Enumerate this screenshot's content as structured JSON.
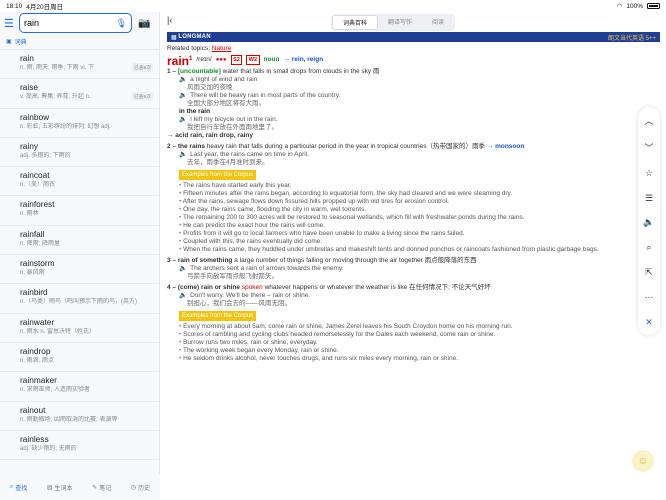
{
  "status": {
    "time": "18:10",
    "date": "4月20日周日",
    "battery": "100%"
  },
  "search": {
    "value": "rain"
  },
  "dict_label": "词典",
  "words": [
    {
      "w": "rain",
      "d": "n. 雨; 雨天; 雨季; 下雨 vi. 下",
      "tag": "已查5次"
    },
    {
      "w": "raise",
      "d": "v. 提高; 筹集; 养育; 升起 n.",
      "tag": "已查9次"
    },
    {
      "w": "rainbow",
      "d": "n. 彩虹; 五彩缤纷的排列; 幻想 adj.",
      "tag": ""
    },
    {
      "w": "rainy",
      "d": "adj. 多雨的; 下雨的",
      "tag": ""
    },
    {
      "w": "raincoat",
      "d": "n.（美）雨衣",
      "tag": ""
    },
    {
      "w": "rainforest",
      "d": "n. 雨林",
      "tag": ""
    },
    {
      "w": "rainfall",
      "d": "n. 降雨; 降雨量",
      "tag": ""
    },
    {
      "w": "rainstorm",
      "d": "n. 暴风雨",
      "tag": ""
    },
    {
      "w": "rainbird",
      "d": "n.（鸟类）雨鸟（鸣叫预示下雨的鸟，(英方)",
      "tag": ""
    },
    {
      "w": "rainwater",
      "d": "n. 雨水 n. 雷恩沃特（姓氏）",
      "tag": ""
    },
    {
      "w": "raindrop",
      "d": "n. 雨滴; 雨点",
      "tag": ""
    },
    {
      "w": "rainmaker",
      "d": "n. 求雨巫师; 人造雨实验者",
      "tag": ""
    },
    {
      "w": "rainout",
      "d": "n. 雨勤撤场; 因雨取消的比赛; 表演等",
      "tag": ""
    },
    {
      "w": "rainless",
      "d": "adj. 缺少雨的; 无雨的",
      "tag": ""
    }
  ],
  "nav": [
    "查找",
    "生词本",
    "笔记",
    "历史"
  ],
  "tabs": [
    "词典百科",
    "翻译写作",
    "阅读"
  ],
  "band": {
    "brand": "LONGMAN",
    "cn": "朗文当代英语 5++"
  },
  "entry": {
    "related_label": "Related topics:",
    "related": "Nature",
    "word": "rain",
    "sup": "1",
    "pron": "/reɪn/",
    "dots": "●●●",
    "s": "S2",
    "w": "W2",
    "pos": "noun",
    "refs": "→ rein, reign",
    "s1": {
      "num": "1 –",
      "gram": "[uncountable]",
      "def": "water that falls in small drops from clouds in the sky 雨",
      "ex": [
        {
          "en": "a night of wind and rain",
          "zh": "风雨交加的夜晚"
        },
        {
          "en": "There will be heavy rain in most parts of the country.",
          "zh": "全国大部分地区将有大雨。"
        }
      ],
      "phrase": "in the rain",
      "ex2": {
        "en": "I left my bicycle out in the rain.",
        "zh": "我把自行车放在外面雨地里了。"
      },
      "see": "→ acid rain, rain drop, rainy"
    },
    "s2": {
      "num": "2 –",
      "head": "the rains",
      "def": "heavy rain that falls during a particular period in the year in tropical countries（热带国家的）雨季",
      "see": "→ monsoon",
      "ex": {
        "en": "Last year, the rains came on time in April.",
        "zh": "去年，雨季在4月准时到来。"
      }
    },
    "corpus_label": "Examples from the Corpus",
    "c2": [
      "The rains have started early this year.",
      "Fifteen minutes after the rains began, according to equatorial form, the sky had cleared and we were steaming dry.",
      "After the rains, sewage flows down fissured hills propped up with old tires for erosion control.",
      "One day, the rains came, flooding the city in warm, wet torrents.",
      "The remaining 200 to 300 acres will be restored to seasonal wetlands, which fill with freshwater ponds during the rains.",
      "He can predict the exact hour the rains will come.",
      "Profits from it will go to local farmers who have been unable to make a living since the rains failed.",
      "Coupled with this, the rains eventually did come.",
      "When the rains came, they huddled under umbrellas and makeshift tents and donned ponchos or raincoats fashioned from plastic garbage bags."
    ],
    "s3": {
      "num": "3 –",
      "head": "rain of something",
      "def": "a large number of things falling or moving through the air together 雨点般降落的东西",
      "ex": {
        "en": "The archers sent a rain of arrows towards the enemy.",
        "zh": "弓箭手向敌军雨点般飞射箭矢。"
      }
    },
    "s4": {
      "num": "4 –",
      "head": "(come) rain or shine",
      "spoken": "spoken",
      "def": "whatever happens or whatever the weather is like 在任何情况下; 不论天气好坏",
      "ex": {
        "en": "Don't worry. We'll be there – rain or shine.",
        "zh": "别担心，我们会去的——风雨无阻。"
      }
    },
    "c4": [
      "Every morning at about 5am, come rain or shine, James Zerei leaves his South Croydon home on his morning run.",
      "Scores of rambling and cycling clubs headed remorselessly for the Dales each weekend, come rain or shine.",
      "Burrow runs two miles, rain or shine, everyday.",
      "The working week began every Monday, rain or shine.",
      "He seldom drinks alcohol, never touches drugs, and runs six miles every morning, rain or shine."
    ]
  },
  "tools": [
    "chevron-up",
    "chevron-down",
    "star",
    "list",
    "speaker",
    "search",
    "share",
    "more",
    "close"
  ]
}
